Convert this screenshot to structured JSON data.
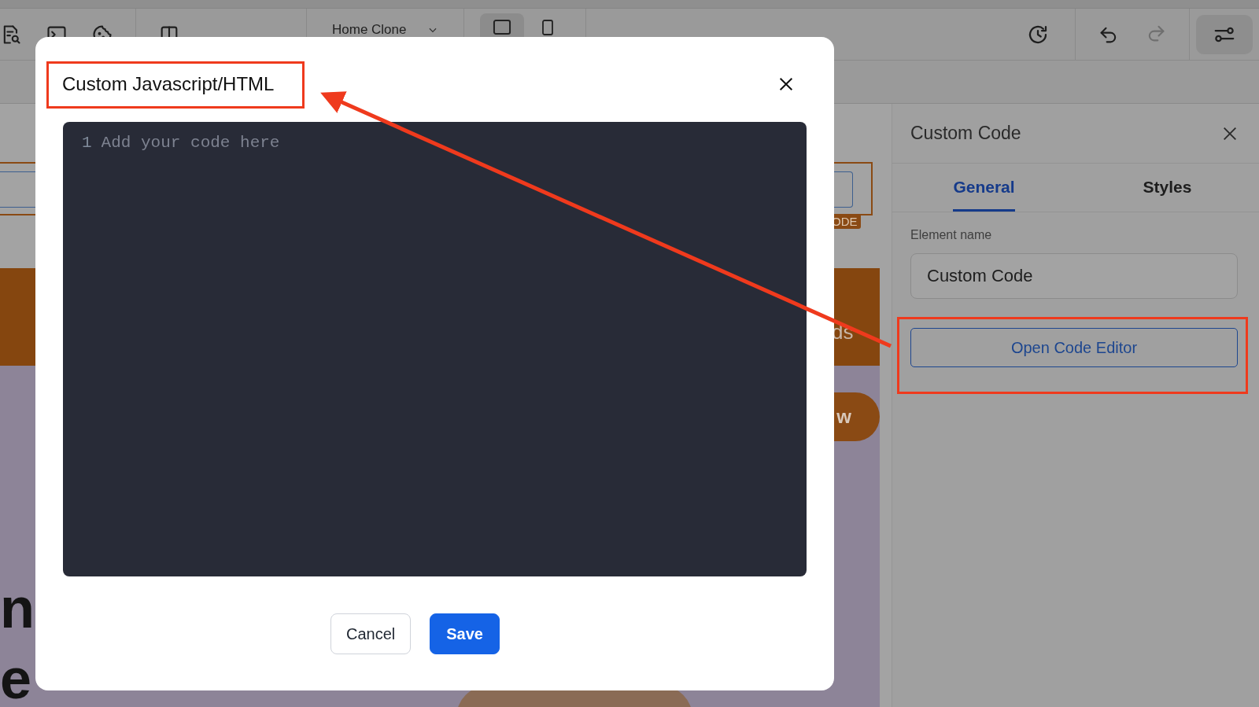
{
  "toolbar": {
    "page_select": {
      "value": "Home Clone"
    },
    "devices": [
      {
        "kind": "desktop",
        "selected": true
      },
      {
        "kind": "mobile",
        "selected": false
      }
    ],
    "redo": {
      "disabled": true
    }
  },
  "canvas": {
    "element_tag": "ODE",
    "banner_text": "ds",
    "button_text": "w",
    "heading_lines": [
      "n",
      "e"
    ]
  },
  "panel": {
    "title": "Custom Code",
    "tabs": [
      {
        "label": "General",
        "selected": true
      },
      {
        "label": "Styles",
        "selected": false
      }
    ],
    "element_name": {
      "label": "Element name",
      "value": "Custom Code"
    },
    "open_button": "Open Code Editor"
  },
  "modal": {
    "title": "Custom Javascript/HTML",
    "editor": {
      "line_number": "1",
      "placeholder": "Add your code here"
    },
    "buttons": [
      {
        "label": "Cancel",
        "kind": "secondary"
      },
      {
        "label": "Save",
        "kind": "primary"
      }
    ]
  }
}
